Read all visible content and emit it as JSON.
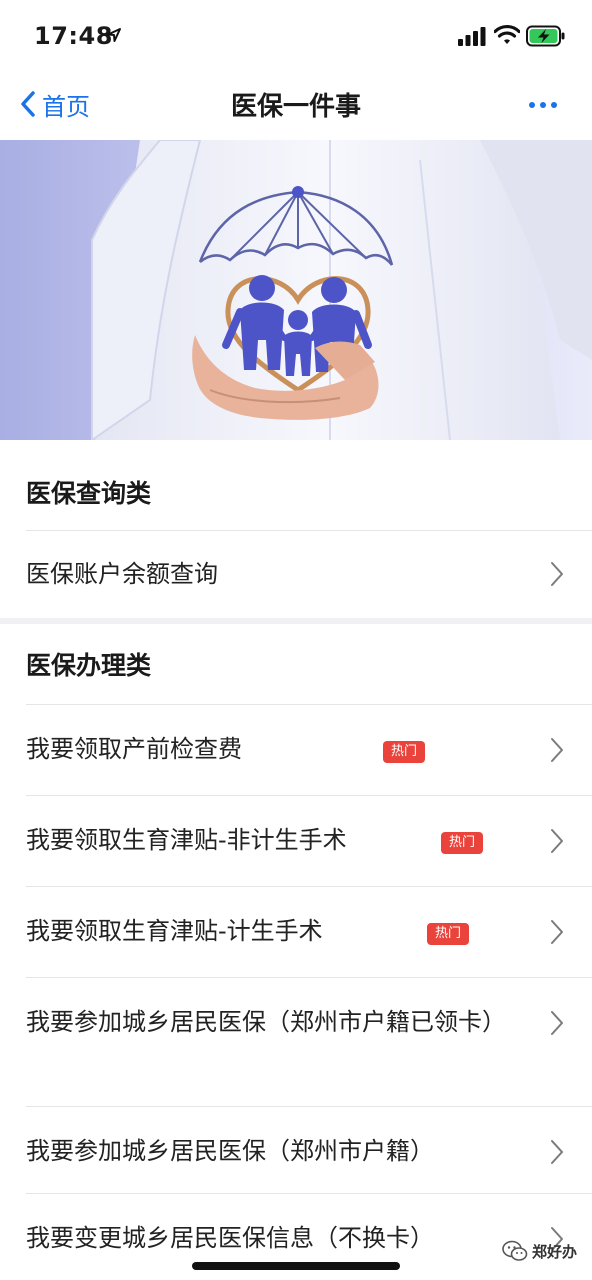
{
  "status_bar": {
    "time": "17:48"
  },
  "nav": {
    "back_label": "首页",
    "title": "医保一件事"
  },
  "sections": [
    {
      "title": "医保查询类",
      "items": [
        {
          "label": "医保账户余额查询"
        }
      ]
    },
    {
      "title": "医保办理类",
      "items": [
        {
          "label": "我要领取产前检查费",
          "badge": "热门"
        },
        {
          "label": "我要领取生育津贴-非计生手术",
          "badge": "热门"
        },
        {
          "label": "我要领取生育津贴-计生手术",
          "badge": "热门"
        },
        {
          "label": "我要参加城乡居民医保（郑州市户籍已领卡）"
        },
        {
          "label": "我要参加城乡居民医保（郑州市户籍）"
        },
        {
          "label": "我要变更城乡居民医保信息（不换卡）"
        }
      ]
    }
  ],
  "watermark": {
    "text": "郑好办"
  },
  "colors": {
    "accent": "#1a73e8",
    "hot_badge": "#e9433c",
    "banner_bg": "#b3b8e6"
  }
}
